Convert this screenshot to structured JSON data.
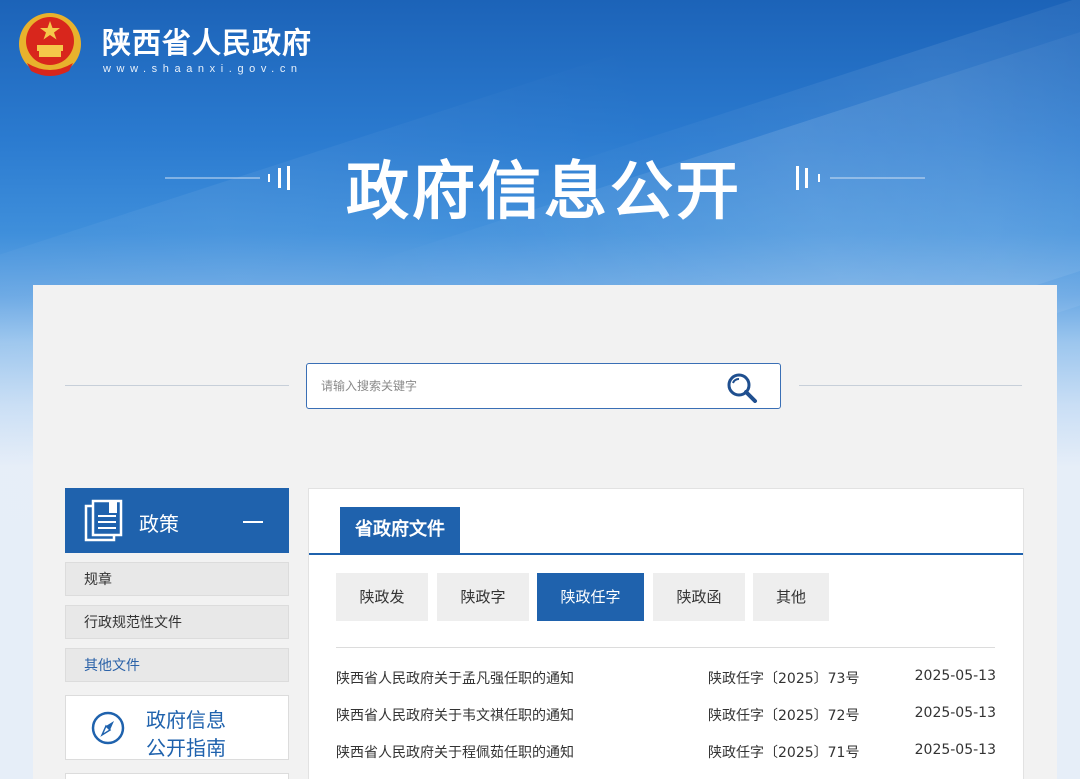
{
  "header": {
    "site_name": "陕西省人民政府",
    "site_url": "www.shaanxi.gov.cn"
  },
  "hero": {
    "title": "政府信息公开"
  },
  "search": {
    "placeholder": "请输入搜索关键字"
  },
  "sidebar": {
    "heading": "政策",
    "items": [
      {
        "label": "规章"
      },
      {
        "label": "行政规范性文件"
      },
      {
        "label": "其他文件"
      }
    ],
    "guide_line1": "政府信息",
    "guide_line2": "公开指南"
  },
  "main": {
    "section_title": "省政府文件",
    "tabs": [
      {
        "label": "陕政发",
        "active": false
      },
      {
        "label": "陕政字",
        "active": false
      },
      {
        "label": "陕政任字",
        "active": true
      },
      {
        "label": "陕政函",
        "active": false
      },
      {
        "label": "其他",
        "active": false
      }
    ],
    "rows": [
      {
        "title": "陕西省人民政府关于孟凡强任职的通知",
        "doc_number": "陕政任字〔2025〕73号",
        "date": "2025-05-13"
      },
      {
        "title": "陕西省人民政府关于韦文祺任职的通知",
        "doc_number": "陕政任字〔2025〕72号",
        "date": "2025-05-13"
      },
      {
        "title": "陕西省人民政府关于程佩茹任职的通知",
        "doc_number": "陕政任字〔2025〕71号",
        "date": "2025-05-13"
      }
    ]
  },
  "colors": {
    "primary_blue": "#1f62ad",
    "panel_bg": "#f2f2f2"
  },
  "icons": [
    "national-emblem-icon",
    "search-icon",
    "document-icon",
    "collapse-minus-icon",
    "compass-icon"
  ]
}
